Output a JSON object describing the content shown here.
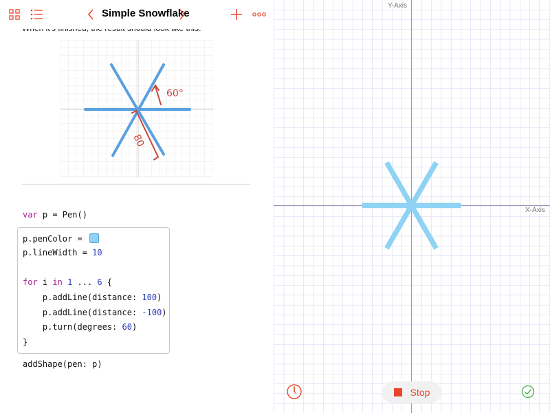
{
  "colors": {
    "accent": "#e8452c",
    "keyword": "#a4238e",
    "number": "#2a3ab8",
    "snowflake": "#8fd3f4",
    "grid": "#c8c8f0",
    "illustration_line": "#5aa0e0",
    "annotation": "#c4473a"
  },
  "toolbar": {
    "title": "Simple Snowflake",
    "icons": [
      "grid-view-icon",
      "list-icon",
      "chevron-left-icon",
      "chevron-right-icon",
      "plus-icon",
      "more-icon"
    ]
  },
  "content": {
    "clipped_sentence": "When it's finished, the result should look like this:",
    "illustration": {
      "angle_annotation": "60°",
      "length_annotation": "80"
    }
  },
  "code": {
    "line1_a": "var",
    "line1_b": " p = Pen()",
    "line2": "p.penColor = ",
    "line3_a": "p.lineWidth = ",
    "line3_b": "10",
    "line4_a": "for",
    "line4_b": " i ",
    "line4_c": "in",
    "line4_d": " ",
    "line4_e": "1",
    "line4_f": " ... ",
    "line4_g": "6",
    "line4_h": " {",
    "line5_a": "    p.addLine(distance: ",
    "line5_b": "100",
    "line5_c": ")",
    "line6_a": "    p.addLine(distance: ",
    "line6_b": "-100",
    "line6_c": ")",
    "line7_a": "    p.turn(degrees: ",
    "line7_b": "60",
    "line7_c": ")",
    "line8": "}",
    "line9": "addShape(pen: p)"
  },
  "canvas": {
    "y_axis_label": "Y-Axis",
    "x_axis_label": "X-Axis",
    "line_width": 10,
    "pen_distance": 100,
    "turn_degrees": 60,
    "repeat_count": 6
  },
  "controls": {
    "stop_label": "Stop"
  }
}
